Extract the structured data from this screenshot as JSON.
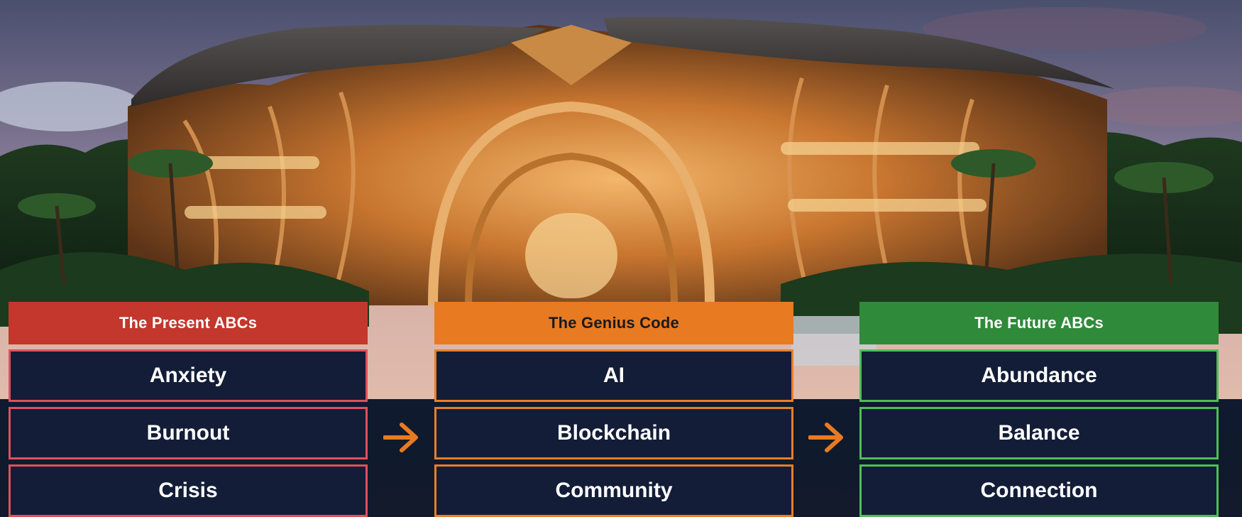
{
  "columns": [
    {
      "header": "The Present ABCs",
      "items": [
        "Anxiety",
        "Burnout",
        "Crisis"
      ]
    },
    {
      "header": "The Genius Code",
      "items": [
        "AI",
        "Blockchain",
        "Community"
      ]
    },
    {
      "header": "The Future ABCs",
      "items": [
        "Abundance",
        "Balance",
        "Connection"
      ]
    }
  ],
  "colors": {
    "present": "#c3372c",
    "genius": "#e87a22",
    "future": "#2f8a3a",
    "box_fill": "#131d37",
    "arrow": "#e87a22"
  },
  "icons": {
    "transition": "arrow-right-icon"
  }
}
